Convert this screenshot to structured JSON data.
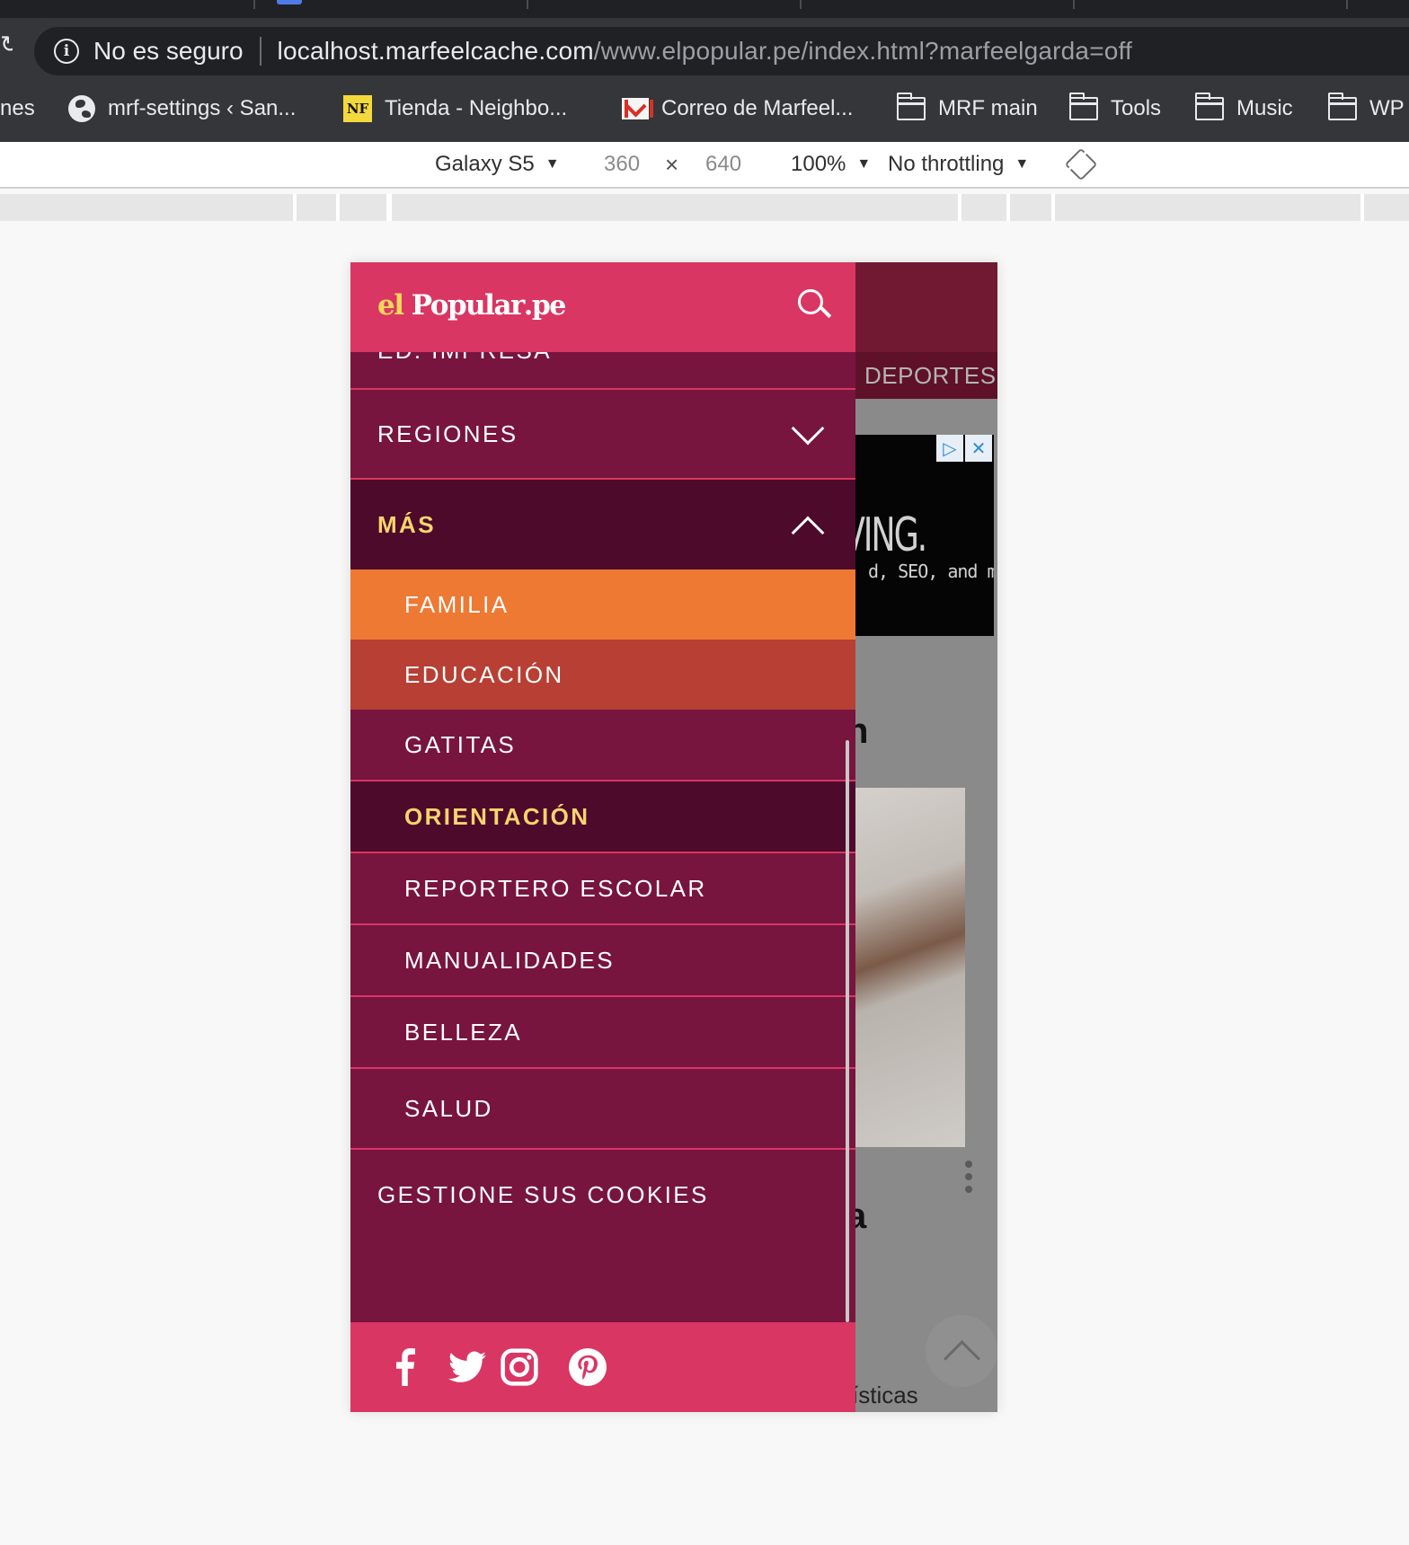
{
  "browser": {
    "security_label": "No es seguro",
    "url_host": "localhost.marfeelcache.com",
    "url_path": "/www.elpopular.pe/index.html?marfeelgarda=off",
    "bookmarks": [
      {
        "label": "nes",
        "icon": "none"
      },
      {
        "label": "mrf-settings ‹ San...",
        "icon": "globe-icon"
      },
      {
        "label": "Tienda - Neighbo...",
        "icon": "nf-icon"
      },
      {
        "label": "Correo de Marfeel...",
        "icon": "gmail-icon"
      },
      {
        "label": "MRF main",
        "icon": "folder-icon"
      },
      {
        "label": "Tools",
        "icon": "folder-icon"
      },
      {
        "label": "Music",
        "icon": "folder-icon"
      },
      {
        "label": "WP",
        "icon": "folder-icon"
      }
    ]
  },
  "devtools": {
    "device": "Galaxy S5",
    "width": "360",
    "times": "×",
    "height": "640",
    "zoom": "100%",
    "throttling": "No throttling"
  },
  "site": {
    "logo_el": "el",
    "logo_popular": "Popular",
    "logo_pe": ".pe",
    "bg_nav_label": "DEPORTES",
    "ad_headline": "VING.",
    "ad_subline": "d, SEO, and more",
    "ad_badge_play": "▷",
    "ad_badge_close": "✕",
    "bg_fragment_1": "n",
    "bg_fragment_2": "a",
    "bg_fragment_3": "ísticas"
  },
  "menu": {
    "partial_top": "ED. IMPRESA",
    "regiones": "REGIONES",
    "mas": "MÁS",
    "subitems": [
      "FAMILIA",
      "EDUCACIÓN",
      "GATITAS",
      "ORIENTACIÓN",
      "REPORTERO ESCOLAR",
      "MANUALIDADES",
      "BELLEZA",
      "SALUD"
    ],
    "cookies": "GESTIONE SUS COOKIES"
  },
  "social": [
    "facebook-icon",
    "twitter-icon",
    "instagram-icon",
    "pinterest-icon"
  ],
  "colors": {
    "header_pink": "#d93663",
    "drawer_bg": "#77153e",
    "active_bg": "#4e0a2b",
    "active_text": "#f7d56d",
    "familia": "#ee7933",
    "educacion": "#b83f33"
  }
}
